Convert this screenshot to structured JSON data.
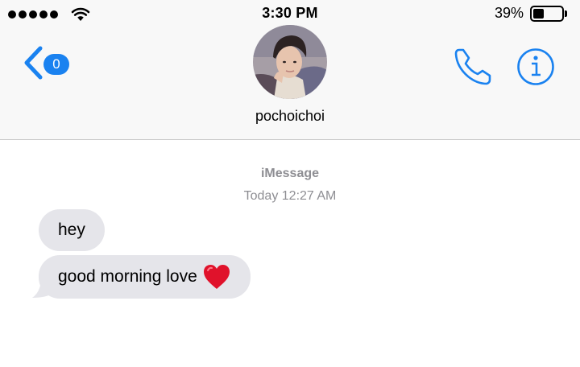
{
  "status_bar": {
    "time": "3:30 PM",
    "battery_percent": "39%",
    "battery_level": 0.39,
    "signal_bars": 5,
    "wifi_icon": "wifi-icon"
  },
  "nav": {
    "unread_count": "0",
    "back_icon": "chevron-left-icon",
    "contact_name": "pochoichoi",
    "call_icon": "phone-icon",
    "info_icon": "info-icon",
    "accent_color": "#1a82f0"
  },
  "conversation": {
    "service": "iMessage",
    "timestamp": "Today 12:27 AM",
    "messages": [
      {
        "text": "hey",
        "direction": "incoming"
      },
      {
        "text": "good morning love",
        "direction": "incoming",
        "emoji": "red-heart"
      }
    ],
    "bubble_color": "#e5e5ea"
  }
}
